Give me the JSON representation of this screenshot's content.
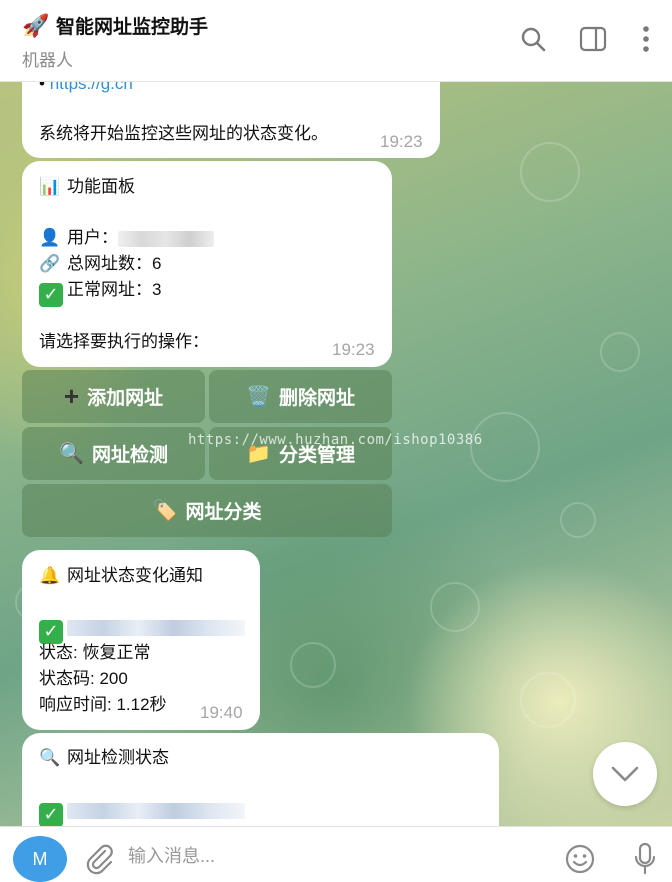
{
  "header": {
    "title": "智能网址监控助手",
    "subtitle": "机器人",
    "icons": [
      "rocket-icon",
      "search-icon",
      "sidebar-toggle-icon",
      "more-vertical-icon"
    ]
  },
  "messages": {
    "m1": {
      "link": "https://g.cn",
      "text": "系统将开始监控这些网址的状态变化。",
      "time": "19:23"
    },
    "m2": {
      "title": "功能面板",
      "user_label": "用户：",
      "total_label": "总网址数：",
      "total_value": "6",
      "ok_label": "正常网址：",
      "ok_value": "3",
      "prompt": "请选择要执行的操作：",
      "time": "19:23"
    },
    "keyboard": {
      "add": "添加网址",
      "delete": "删除网址",
      "check": "网址检测",
      "category_manage": "分类管理",
      "classify": "网址分类"
    },
    "m3": {
      "title": "网址状态变化通知",
      "status": "状态: 恢复正常",
      "code": "状态码: 200",
      "resp": "响应时间: 1.12秒",
      "time": "19:40"
    },
    "m4": {
      "title": "网址检测状态"
    }
  },
  "watermark": "https://www.huzhan.com/ishop10386",
  "composer": {
    "avatar": "M",
    "placeholder": "输入消息..."
  },
  "colors": {
    "accent": "#3f9ee6",
    "link": "#2f8fd8",
    "check_green": "#34b04a"
  }
}
